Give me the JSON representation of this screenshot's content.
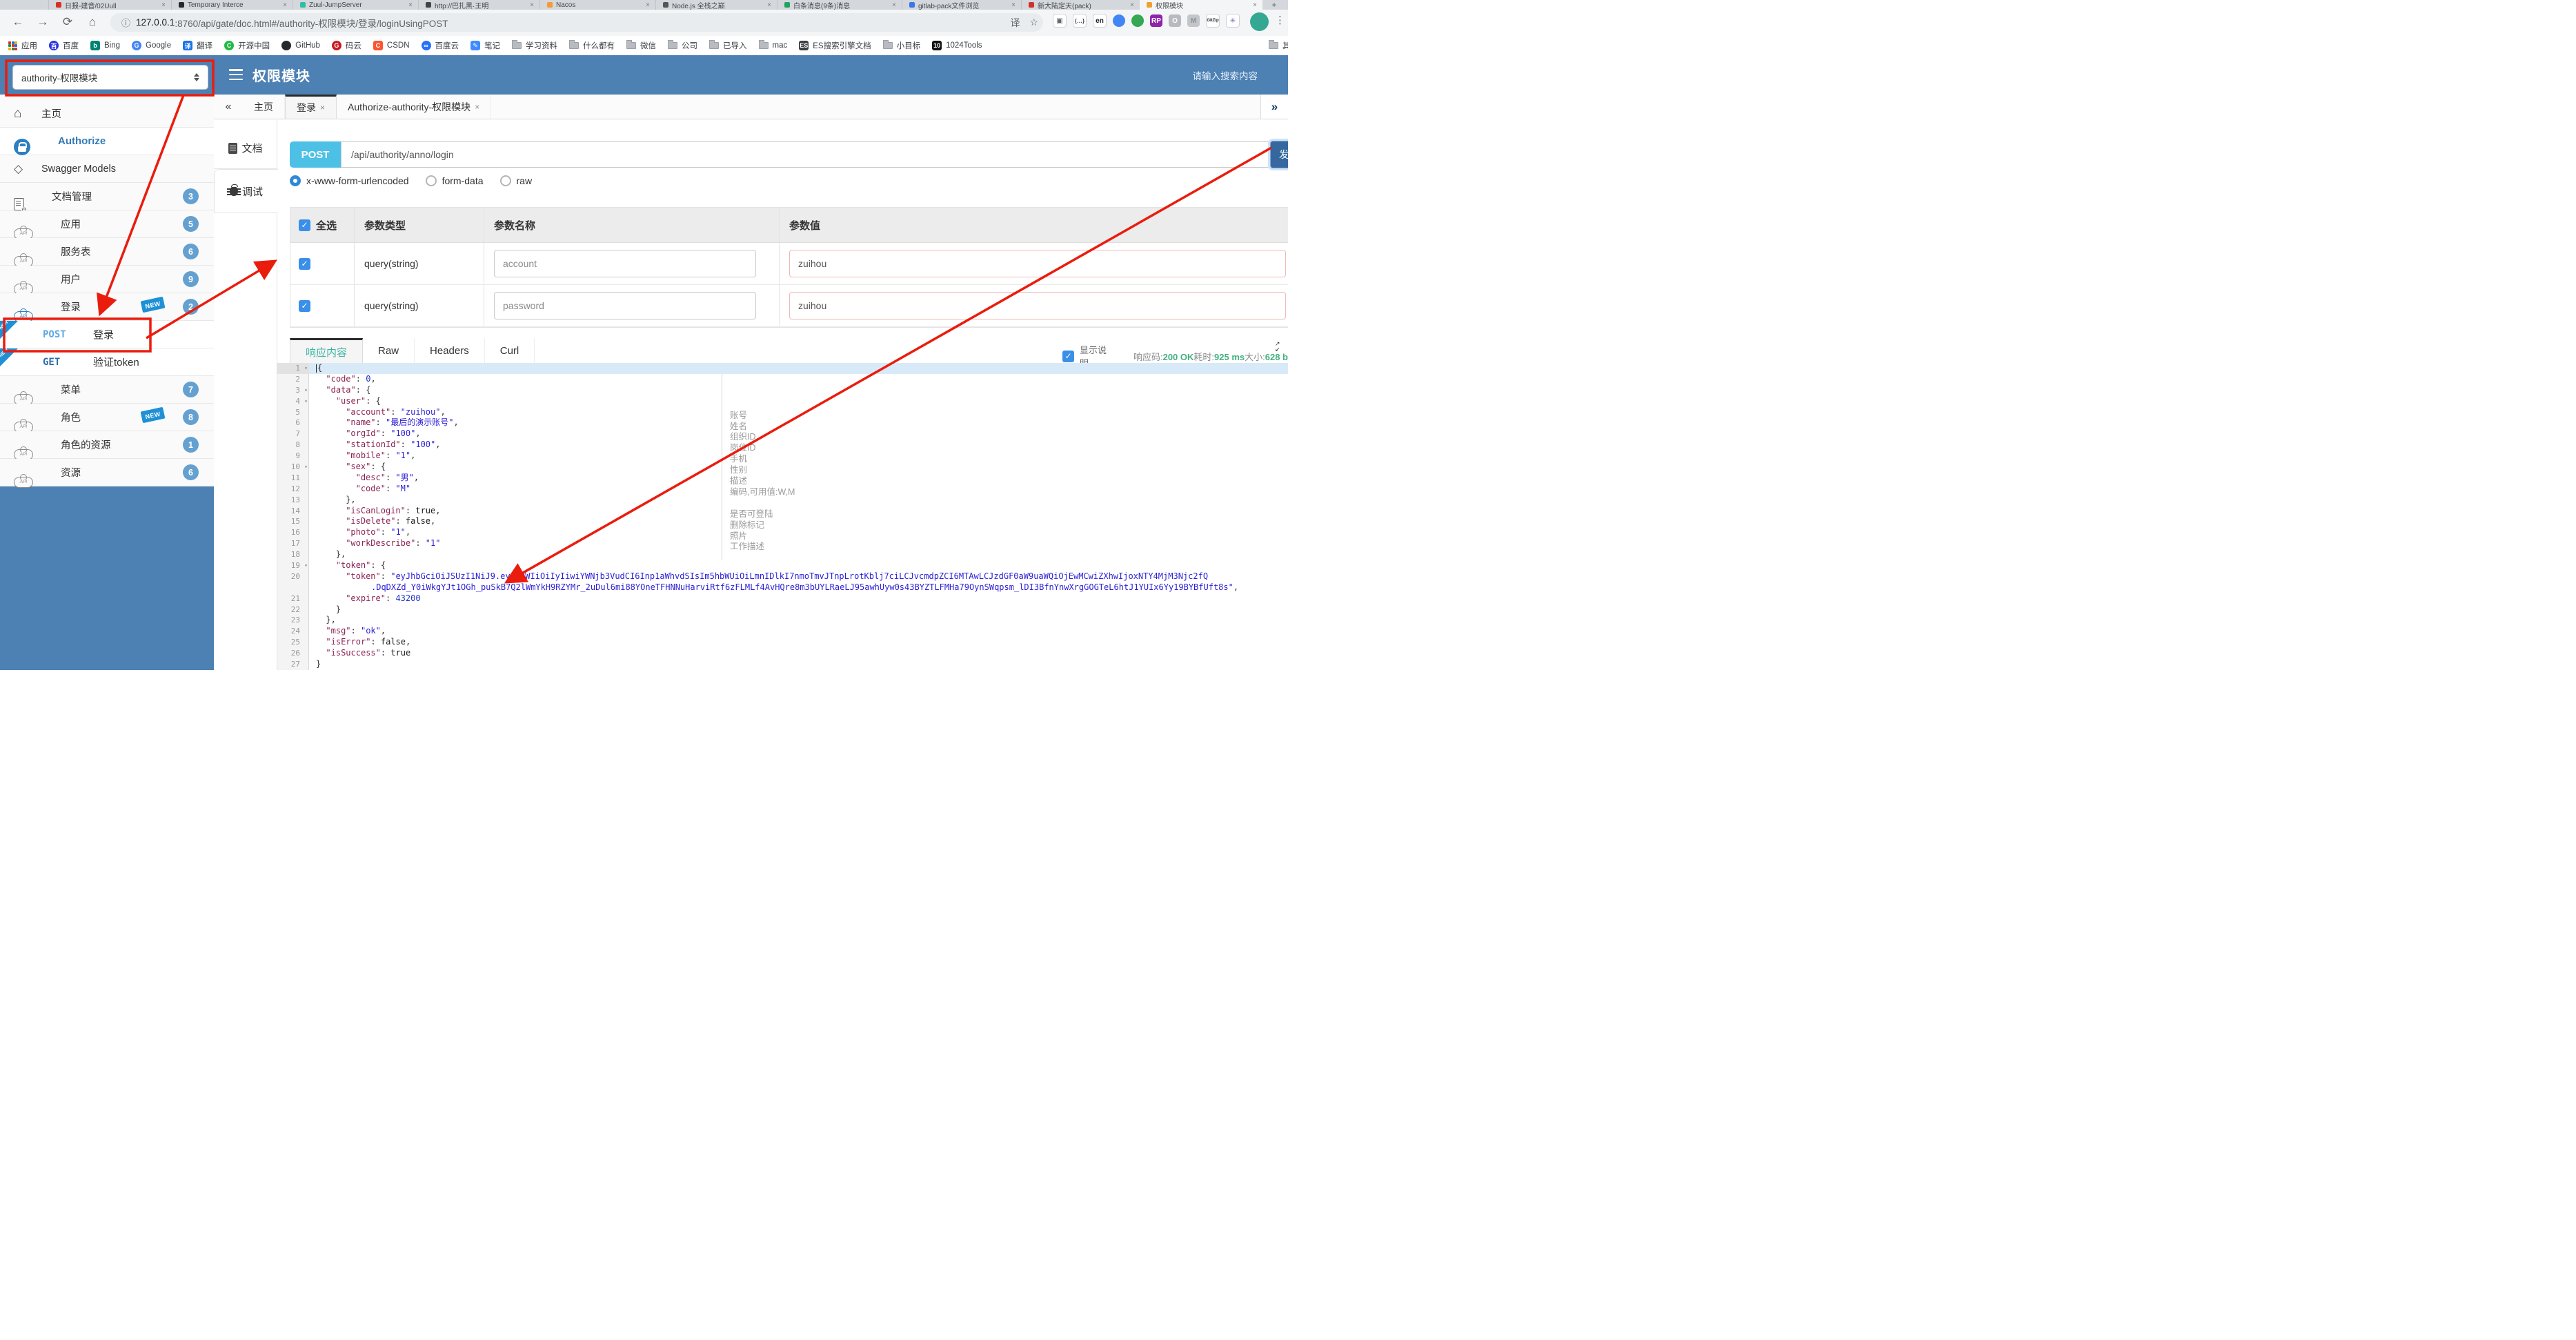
{
  "browser": {
    "tabs": [
      {
        "title": "日报-建音/02Uull",
        "color": "#d93025",
        "close": "×"
      },
      {
        "title": "Temporary Interce",
        "color": "#24292e",
        "close": "×"
      },
      {
        "title": "Zuul-JumpServer",
        "color": "#2bbfa4",
        "close": "×"
      },
      {
        "title": "http://巴扎黑·王明",
        "color": "#444444",
        "close": "×"
      },
      {
        "title": "Nacos",
        "color": "#f29b38",
        "close": "×"
      },
      {
        "title": "Node.js 全栈之巅",
        "color": "#555555",
        "close": "×"
      },
      {
        "title": "白条消息(9条)消息",
        "color": "#21a366",
        "close": "×"
      },
      {
        "title": "gitlab-pack文件浏览",
        "color": "#3b78e7",
        "close": "×"
      },
      {
        "title": "新大陆定天(pack)",
        "color": "#d32f2f",
        "close": "×"
      },
      {
        "title": "权限模块",
        "color": "#f0a030",
        "close": "×",
        "active": true
      }
    ],
    "new_tab": "+",
    "nav": {
      "back": "←",
      "forward": "→",
      "reload": "⟳",
      "home": "⌂"
    },
    "url_info_icon": "ⓘ",
    "url_host": "127.0.0.1",
    "url_rest": ":8760/api/gate/doc.html#/authority-权限模块/登录/loginUsingPOST",
    "pill_icons": {
      "translate": "译",
      "star": "☆"
    },
    "extensions": [
      {
        "name": "screenshot-ext-icon",
        "glyph": "▣",
        "bg": "#ffffff",
        "fg": "#5f6368"
      },
      {
        "name": "braces-ext-icon",
        "glyph": "{…}",
        "bg": "#ffffff",
        "fg": "#444444"
      },
      {
        "name": "en-translate-ext-icon",
        "glyph": "en",
        "bg": "#ffffff",
        "fg": "#222222"
      },
      {
        "name": "chrome-ext-icon",
        "glyph": "",
        "bg": "#4285f4",
        "fg": "#ffffff"
      },
      {
        "name": "globe-ext-icon",
        "glyph": "",
        "bg": "#34a853",
        "fg": "#ffffff"
      },
      {
        "name": "rp-ext-icon",
        "glyph": "RP",
        "bg": "#8e24aa",
        "fg": "#ffffff"
      },
      {
        "name": "ring-ext-icon",
        "glyph": "O",
        "bg": "#b7bbbf",
        "fg": "#ffffff"
      },
      {
        "name": "chevron-ext-icon",
        "glyph": "M",
        "bg": "#c2c6ca",
        "fg": "#8c9196"
      },
      {
        "name": "gitzip-ext-icon",
        "glyph": "GitZip",
        "bg": "#ffffff",
        "fg": "#222222"
      },
      {
        "name": "pinwheel-ext-icon",
        "glyph": "✳",
        "bg": "#ffffff",
        "fg": "#7b61c4"
      }
    ],
    "bookmarks": [
      {
        "label": "应用",
        "icon": "grid",
        "color": "#d93025"
      },
      {
        "label": "百度",
        "icon": "round",
        "color": "#2932e1",
        "letter": "百"
      },
      {
        "label": "Bing",
        "icon": "square",
        "color": "#008373",
        "letter": "b"
      },
      {
        "label": "Google",
        "icon": "round",
        "color": "#4285f4",
        "letter": "G"
      },
      {
        "label": "翻译",
        "icon": "square",
        "color": "#1a73e8",
        "letter": "译"
      },
      {
        "label": "开源中国",
        "icon": "round",
        "color": "#21ba45",
        "letter": "C"
      },
      {
        "label": "GitHub",
        "icon": "round",
        "color": "#24292e",
        "letter": ""
      },
      {
        "label": "码云",
        "icon": "round",
        "color": "#c71d23",
        "letter": "G"
      },
      {
        "label": "CSDN",
        "icon": "square",
        "color": "#fc5531",
        "letter": "C"
      },
      {
        "label": "百度云",
        "icon": "round",
        "color": "#2871fa",
        "letter": "∞"
      },
      {
        "label": "笔记",
        "icon": "square",
        "color": "#3f8cff",
        "letter": "✎"
      },
      {
        "label": "学习资料",
        "icon": "folder"
      },
      {
        "label": "什么都有",
        "icon": "folder"
      },
      {
        "label": "微信",
        "icon": "folder"
      },
      {
        "label": "公司",
        "icon": "folder"
      },
      {
        "label": "已导入",
        "icon": "folder"
      },
      {
        "label": "mac",
        "icon": "folder"
      },
      {
        "label": "ES搜索引擎文档",
        "icon": "square",
        "color": "#3a3f44",
        "letter": "ES"
      },
      {
        "label": "小目标",
        "icon": "folder"
      },
      {
        "label": "1024Tools",
        "icon": "square",
        "color": "#111111",
        "letter": "10"
      }
    ],
    "other_bookmarks": "其他书签"
  },
  "header": {
    "module_select": "authority-权限模块",
    "title": "权限模块",
    "search_placeholder": "请输入搜索内容"
  },
  "sidebar": {
    "items": [
      {
        "label": "主页",
        "icon": "home"
      },
      {
        "label": "Authorize",
        "icon": "lock",
        "active": true
      },
      {
        "label": "Swagger Models",
        "icon": "hexagon"
      },
      {
        "label": "文档管理",
        "icon": "doc-gear",
        "badge": "3"
      },
      {
        "label": "应用",
        "icon": "cloud-api",
        "badge": "5"
      },
      {
        "label": "服务表",
        "icon": "cloud-api",
        "badge": "6"
      },
      {
        "label": "用户",
        "icon": "cloud-api",
        "badge": "9"
      },
      {
        "label": "登录",
        "icon": "cloud-api-blue",
        "badge": "2",
        "new": true
      },
      {
        "type": "endpoint",
        "method": "POST",
        "label": "登录",
        "new": true
      },
      {
        "type": "endpoint",
        "method": "GET",
        "label": "验证token",
        "new": true
      },
      {
        "label": "菜单",
        "icon": "cloud-api",
        "badge": "7"
      },
      {
        "label": "角色",
        "icon": "cloud-api",
        "badge": "8",
        "new": true
      },
      {
        "label": "角色的资源",
        "icon": "cloud-api",
        "badge": "1"
      },
      {
        "label": "资源",
        "icon": "cloud-api",
        "badge": "6"
      }
    ],
    "new_badge_text": "NEW"
  },
  "tabbar": {
    "collapse": "«",
    "expand": "»",
    "tabs": [
      {
        "label": "主页"
      },
      {
        "label": "登录",
        "close": "×",
        "active": true
      },
      {
        "label": "Authorize-authority-权限模块",
        "close": "×"
      }
    ]
  },
  "doc_tabs": {
    "doc": "文档",
    "debug": "调试"
  },
  "request": {
    "method": "POST",
    "url": "/api/authority/anno/login",
    "send_label": "发送",
    "modes": [
      "x-www-form-urlencoded",
      "form-data",
      "raw"
    ],
    "selected_mode": 0
  },
  "params_table": {
    "headers": {
      "select_all": "全选",
      "type": "参数类型",
      "name": "参数名称",
      "value": "参数值"
    },
    "rows": [
      {
        "checked": true,
        "type": "query(string)",
        "name": "account",
        "value": "zuihou"
      },
      {
        "checked": true,
        "type": "query(string)",
        "name": "password",
        "value": "zuihou"
      }
    ]
  },
  "response": {
    "tabs": [
      {
        "label": "响应内容",
        "active": true
      },
      {
        "label": "Raw"
      },
      {
        "label": "Headers"
      },
      {
        "label": "Curl"
      }
    ],
    "show_desc_label": "显示说明",
    "show_desc_checked": true,
    "meta": [
      {
        "label": "响应码:",
        "value": "200 OK"
      },
      {
        "label": "耗时:",
        "value": "925 ms"
      },
      {
        "label": "大小:",
        "value": "628 b"
      }
    ]
  },
  "editor": {
    "rows": [
      {
        "n": 1,
        "f": 1,
        "a": 1,
        "i": 0,
        "s": [
          [
            "p",
            "{"
          ]
        ]
      },
      {
        "n": 2,
        "i": 1,
        "s": [
          [
            "k",
            "\"code\""
          ],
          [
            "p",
            ": "
          ],
          [
            "n",
            "0"
          ],
          [
            "p",
            ","
          ]
        ]
      },
      {
        "n": 3,
        "f": 1,
        "i": 1,
        "s": [
          [
            "k",
            "\"data\""
          ],
          [
            "p",
            ": {"
          ]
        ]
      },
      {
        "n": 4,
        "f": 1,
        "i": 2,
        "s": [
          [
            "k",
            "\"user\""
          ],
          [
            "p",
            ": {"
          ]
        ]
      },
      {
        "n": 5,
        "i": 3,
        "s": [
          [
            "k",
            "\"account\""
          ],
          [
            "p",
            ": "
          ],
          [
            "s",
            "\"zuihou\""
          ],
          [
            "p",
            ","
          ]
        ]
      },
      {
        "n": 6,
        "i": 3,
        "s": [
          [
            "k",
            "\"name\""
          ],
          [
            "p",
            ": "
          ],
          [
            "s",
            "\"最后的演示账号\""
          ],
          [
            "p",
            ","
          ]
        ]
      },
      {
        "n": 7,
        "i": 3,
        "s": [
          [
            "k",
            "\"orgId\""
          ],
          [
            "p",
            ": "
          ],
          [
            "s",
            "\"100\""
          ],
          [
            "p",
            ","
          ]
        ]
      },
      {
        "n": 8,
        "i": 3,
        "s": [
          [
            "k",
            "\"stationId\""
          ],
          [
            "p",
            ": "
          ],
          [
            "s",
            "\"100\""
          ],
          [
            "p",
            ","
          ]
        ]
      },
      {
        "n": 9,
        "i": 3,
        "s": [
          [
            "k",
            "\"mobile\""
          ],
          [
            "p",
            ": "
          ],
          [
            "s",
            "\"1\""
          ],
          [
            "p",
            ","
          ]
        ]
      },
      {
        "n": 10,
        "f": 1,
        "i": 3,
        "s": [
          [
            "k",
            "\"sex\""
          ],
          [
            "p",
            ": {"
          ]
        ]
      },
      {
        "n": 11,
        "i": 4,
        "s": [
          [
            "k",
            "\"desc\""
          ],
          [
            "p",
            ": "
          ],
          [
            "s",
            "\"男\""
          ],
          [
            "p",
            ","
          ]
        ]
      },
      {
        "n": 12,
        "i": 4,
        "s": [
          [
            "k",
            "\"code\""
          ],
          [
            "p",
            ": "
          ],
          [
            "s",
            "\"M\""
          ]
        ]
      },
      {
        "n": 13,
        "i": 3,
        "s": [
          [
            "p",
            "},"
          ]
        ]
      },
      {
        "n": 14,
        "i": 3,
        "s": [
          [
            "k",
            "\"isCanLogin\""
          ],
          [
            "p",
            ": "
          ],
          [
            "b",
            "true"
          ],
          [
            "p",
            ","
          ]
        ]
      },
      {
        "n": 15,
        "i": 3,
        "s": [
          [
            "k",
            "\"isDelete\""
          ],
          [
            "p",
            ": "
          ],
          [
            "b",
            "false"
          ],
          [
            "p",
            ","
          ]
        ]
      },
      {
        "n": 16,
        "i": 3,
        "s": [
          [
            "k",
            "\"photo\""
          ],
          [
            "p",
            ": "
          ],
          [
            "s",
            "\"1\""
          ],
          [
            "p",
            ","
          ]
        ]
      },
      {
        "n": 17,
        "i": 3,
        "s": [
          [
            "k",
            "\"workDescribe\""
          ],
          [
            "p",
            ": "
          ],
          [
            "s",
            "\"1\""
          ]
        ]
      },
      {
        "n": 18,
        "i": 2,
        "s": [
          [
            "p",
            "},"
          ]
        ]
      },
      {
        "n": 19,
        "f": 1,
        "i": 2,
        "s": [
          [
            "k",
            "\"token\""
          ],
          [
            "p",
            ": {"
          ]
        ]
      },
      {
        "n": 20,
        "i": 3,
        "s": [
          [
            "k",
            "\"token\""
          ],
          [
            "p",
            ": "
          ],
          [
            "s",
            "\"eyJhbGciOiJSUzI1NiJ9.eyJzdWIiOiIyIiwiYWNjb3VudCI6Inp1aWhvdSIsIm5hbWUiOiLmnIDlkI7nmoTmvJTnpLrotKblj7ciLCJvcmdpZCI6MTAwLCJzdGF0aW9uaWQiOjEwMCwiZXhwIjoxNTY4MjM3Njc2fQ"
          ]
        ]
      },
      {
        "n": null,
        "ipx": 80,
        "s": [
          [
            "s",
            ".DqDXZd_Y0iWkgYJt1OGh_puSkB7Q2lWmYkH9RZYMr_2uDul6mi88YOneTFHNNuHarviRtf6zFLMLf4AvHQre8m3bUYLRaeLJ95awhUyw0s43BYZTLFMHa79OynSWqpsm_lDI3BfnYnwXrgGOGTeL6htJ1YUIx6Yy19BYBfUft8s\""
          ],
          [
            "p",
            ","
          ]
        ]
      },
      {
        "n": 21,
        "i": 3,
        "s": [
          [
            "k",
            "\"expire\""
          ],
          [
            "p",
            ": "
          ],
          [
            "n",
            "43200"
          ]
        ]
      },
      {
        "n": 22,
        "i": 2,
        "s": [
          [
            "p",
            "}"
          ]
        ]
      },
      {
        "n": 23,
        "i": 1,
        "s": [
          [
            "p",
            "},"
          ]
        ]
      },
      {
        "n": 24,
        "i": 1,
        "s": [
          [
            "k",
            "\"msg\""
          ],
          [
            "p",
            ": "
          ],
          [
            "s",
            "\"ok\""
          ],
          [
            "p",
            ","
          ]
        ]
      },
      {
        "n": 25,
        "i": 1,
        "s": [
          [
            "k",
            "\"isError\""
          ],
          [
            "p",
            ": "
          ],
          [
            "b",
            "false"
          ],
          [
            "p",
            ","
          ]
        ]
      },
      {
        "n": 26,
        "i": 1,
        "s": [
          [
            "k",
            "\"isSuccess\""
          ],
          [
            "p",
            ": "
          ],
          [
            "b",
            "true"
          ]
        ]
      },
      {
        "n": 27,
        "i": 0,
        "s": [
          [
            "p",
            "}"
          ]
        ]
      }
    ],
    "annotations": [
      {
        "row": 5,
        "text": "账号"
      },
      {
        "row": 6,
        "text": "姓名"
      },
      {
        "row": 7,
        "text": "组织ID"
      },
      {
        "row": 8,
        "text": "岗位ID"
      },
      {
        "row": 9,
        "text": "手机"
      },
      {
        "row": 10,
        "text": "性别"
      },
      {
        "row": 11,
        "text": "描述"
      },
      {
        "row": 12,
        "text": "编码,可用值:W,M"
      },
      {
        "row": 14,
        "text": "是否可登陆"
      },
      {
        "row": 15,
        "text": "删除标记"
      },
      {
        "row": 16,
        "text": "照片"
      },
      {
        "row": 17,
        "text": "工作描述"
      }
    ]
  },
  "colors": {
    "header_blue": "#4d80b3",
    "method_badge": "#4dc0e6",
    "send_button": "#36689f",
    "badge_blue": "#64a0d0",
    "new_badge": "#1e90d6",
    "success_green": "#42b07e",
    "annotation_red": "#ea1c0d",
    "active_tab_teal": "#3cb5a2"
  }
}
